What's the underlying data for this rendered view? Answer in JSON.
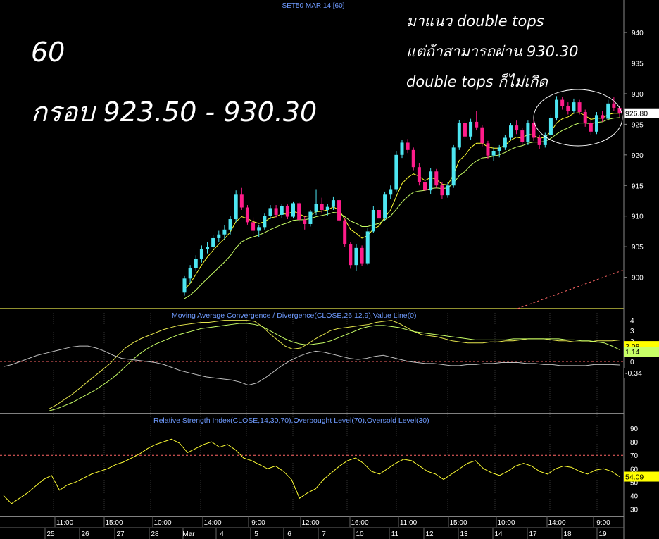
{
  "header": {
    "title": "SET50 MAR 14   [60]"
  },
  "annotations": {
    "timeframe": "60",
    "range": "กรอบ 923.50 - 930.30",
    "note_line1": "มาแนว double tops",
    "note_line2": "แต่ถ้าสามารถผ่าน 930.30",
    "note_line3": "double tops ก็ไม่เกิด"
  },
  "colors": {
    "background": "#000000",
    "bull_candle": "#4de6f2",
    "bear_candle": "#ff1c8a",
    "ma_fast": "#ffff33",
    "ma_slow": "#c8ff66",
    "divider": "#e6e64d",
    "last_price_box": "#ffffff",
    "macd_box": "#ffff00",
    "rsi_box": "#ffff00",
    "axis_text": "#ffffff",
    "indicator_title": "#6f9bff",
    "ref_dashed": "#ff6666"
  },
  "chart_data": [
    {
      "type": "candlestick",
      "title": "SET50 MAR 14   [60]",
      "ylim": [
        895,
        943
      ],
      "yticks": [
        900,
        905,
        910,
        915,
        920,
        925,
        930,
        935,
        940
      ],
      "last_price_label": "926.80",
      "x_time_labels": [
        "11:00",
        "15:00",
        "10:00",
        "14:00",
        "9:00",
        "12:00",
        "16:00",
        "11:00",
        "15:00",
        "10:00",
        "14:00",
        "9:00"
      ],
      "x_date_labels": [
        "25",
        "26",
        "27",
        "28",
        "Mar",
        "4",
        "5",
        "6",
        "7",
        "10",
        "11",
        "12",
        "13",
        "14",
        "17",
        "18",
        "19"
      ],
      "candles": [
        [
          897.5,
          900.2,
          897.0,
          899.8
        ],
        [
          899.8,
          902.0,
          899.0,
          901.5
        ],
        [
          901.5,
          903.6,
          901.0,
          903.0
        ],
        [
          903.0,
          905.2,
          902.4,
          904.6
        ],
        [
          904.6,
          905.8,
          903.9,
          905.0
        ],
        [
          905.0,
          906.9,
          904.5,
          906.4
        ],
        [
          906.4,
          907.6,
          905.8,
          907.0
        ],
        [
          907.0,
          908.5,
          906.2,
          907.8
        ],
        [
          907.8,
          910.0,
          907.0,
          909.5
        ],
        [
          909.5,
          914.2,
          909.0,
          913.5
        ],
        [
          913.5,
          914.6,
          911.0,
          911.4
        ],
        [
          911.4,
          911.8,
          908.6,
          909.0
        ],
        [
          909.0,
          909.8,
          907.0,
          907.6
        ],
        [
          907.6,
          908.6,
          906.6,
          908.2
        ],
        [
          908.2,
          910.4,
          907.8,
          910.0
        ],
        [
          910.0,
          911.8,
          909.5,
          911.3
        ],
        [
          911.3,
          911.8,
          909.8,
          910.2
        ],
        [
          910.2,
          912.0,
          909.7,
          911.6
        ],
        [
          911.6,
          911.9,
          909.5,
          909.9
        ],
        [
          909.9,
          912.4,
          909.6,
          912.1
        ],
        [
          912.1,
          912.3,
          909.0,
          909.4
        ],
        [
          909.4,
          910.0,
          907.8,
          908.7
        ],
        [
          908.7,
          911.0,
          908.3,
          910.7
        ],
        [
          910.7,
          914.4,
          910.2,
          912.0
        ],
        [
          912.0,
          913.0,
          910.4,
          911.0
        ],
        [
          911.0,
          912.0,
          910.1,
          911.5
        ],
        [
          911.5,
          913.2,
          911.0,
          912.6
        ],
        [
          912.6,
          912.9,
          909.0,
          909.3
        ],
        [
          909.3,
          909.6,
          905.0,
          905.4
        ],
        [
          905.4,
          905.7,
          901.4,
          902.0
        ],
        [
          902.0,
          905.4,
          901.0,
          904.8
        ],
        [
          904.8,
          905.2,
          901.8,
          902.3
        ],
        [
          902.3,
          908.0,
          902.0,
          907.5
        ],
        [
          907.5,
          911.6,
          907.2,
          911.0
        ],
        [
          911.0,
          911.5,
          909.0,
          909.6
        ],
        [
          909.6,
          914.0,
          909.2,
          913.5
        ],
        [
          913.5,
          915.0,
          912.8,
          914.4
        ],
        [
          914.4,
          920.6,
          914.0,
          920.0
        ],
        [
          920.0,
          922.5,
          919.5,
          922.0
        ],
        [
          922.0,
          922.6,
          920.3,
          920.8
        ],
        [
          920.8,
          921.2,
          917.5,
          918.0
        ],
        [
          918.0,
          918.6,
          915.0,
          915.6
        ],
        [
          915.6,
          916.2,
          913.6,
          914.2
        ],
        [
          914.2,
          917.8,
          913.6,
          917.3
        ],
        [
          917.3,
          917.7,
          914.6,
          915.0
        ],
        [
          915.0,
          915.6,
          912.8,
          913.4
        ],
        [
          913.4,
          915.5,
          913.0,
          915.0
        ],
        [
          915.0,
          921.6,
          914.6,
          921.2
        ],
        [
          921.2,
          925.7,
          920.8,
          925.2
        ],
        [
          925.2,
          925.6,
          922.6,
          923.0
        ],
        [
          923.0,
          925.9,
          922.5,
          925.4
        ],
        [
          925.4,
          927.2,
          924.0,
          924.5
        ],
        [
          924.5,
          924.9,
          921.4,
          921.9
        ],
        [
          921.9,
          922.3,
          919.3,
          919.9
        ],
        [
          919.9,
          921.2,
          919.0,
          920.6
        ],
        [
          920.6,
          921.6,
          919.6,
          921.2
        ],
        [
          921.2,
          923.3,
          920.8,
          922.8
        ],
        [
          922.8,
          925.2,
          922.4,
          924.8
        ],
        [
          924.8,
          925.6,
          923.4,
          924.0
        ],
        [
          924.0,
          924.4,
          921.6,
          922.1
        ],
        [
          922.1,
          925.6,
          921.6,
          925.2
        ],
        [
          925.2,
          926.0,
          922.3,
          922.8
        ],
        [
          922.8,
          923.3,
          921.0,
          921.6
        ],
        [
          921.6,
          923.6,
          921.2,
          923.2
        ],
        [
          923.2,
          926.6,
          922.8,
          926.0
        ],
        [
          926.0,
          929.6,
          925.6,
          929.0
        ],
        [
          929.0,
          929.5,
          927.4,
          928.0
        ],
        [
          928.0,
          928.6,
          926.6,
          927.2
        ],
        [
          927.2,
          929.2,
          926.9,
          928.6
        ],
        [
          928.6,
          929.0,
          926.6,
          927.0
        ],
        [
          927.0,
          927.4,
          924.6,
          925.2
        ],
        [
          925.2,
          925.6,
          923.2,
          923.8
        ],
        [
          923.8,
          927.0,
          923.4,
          926.5
        ],
        [
          926.5,
          927.2,
          925.4,
          925.9
        ],
        [
          925.9,
          929.0,
          925.6,
          928.4
        ],
        [
          928.4,
          929.4,
          927.2,
          927.7
        ],
        [
          927.7,
          928.0,
          926.2,
          926.8
        ]
      ],
      "series": [
        {
          "name": "",
          "color": "#ffff33",
          "values": [
            898.0,
            899.0,
            900.5,
            902.0,
            903.3,
            904.4,
            905.4,
            906.3,
            907.4,
            909.1,
            909.9,
            909.6,
            909.1,
            908.8,
            909.1,
            909.7,
            909.9,
            910.4,
            910.3,
            910.8,
            910.4,
            909.9,
            910.1,
            910.7,
            910.8,
            911.0,
            911.5,
            911.0,
            909.5,
            907.8,
            907.2,
            906.4,
            906.8,
            907.9,
            908.4,
            909.8,
            911.0,
            913.2,
            915.3,
            916.3,
            916.9,
            916.5,
            915.8,
            916.3,
            916.0,
            915.2,
            915.1,
            916.8,
            919.1,
            919.9,
            921.2,
            921.9,
            921.9,
            921.3,
            921.1,
            921.1,
            921.6,
            922.4,
            922.9,
            922.7,
            923.4,
            923.2,
            922.7,
            922.9,
            923.8,
            925.2,
            925.9,
            926.2,
            926.8,
            926.9,
            926.4,
            925.8,
            926.0,
            926.0,
            926.6,
            926.8,
            926.8
          ]
        },
        {
          "name": "",
          "color": "#c8ff66",
          "values": [
            896.5,
            897.1,
            897.9,
            898.9,
            899.8,
            900.7,
            901.6,
            902.5,
            903.5,
            904.8,
            905.8,
            906.3,
            906.6,
            906.9,
            907.3,
            907.8,
            908.2,
            908.6,
            908.9,
            909.3,
            909.4,
            909.4,
            909.6,
            909.9,
            910.1,
            910.3,
            910.6,
            910.5,
            909.9,
            909.2,
            908.8,
            908.3,
            908.3,
            908.6,
            908.8,
            909.4,
            910.0,
            911.1,
            912.3,
            913.2,
            913.9,
            914.1,
            914.2,
            914.5,
            914.6,
            914.5,
            914.6,
            915.4,
            916.6,
            917.3,
            918.3,
            919.0,
            919.5,
            919.6,
            919.8,
            920.0,
            920.4,
            920.9,
            921.3,
            921.5,
            921.9,
            922.1,
            922.1,
            922.2,
            922.7,
            923.4,
            924.0,
            924.4,
            924.9,
            925.2,
            925.2,
            925.1,
            925.3,
            925.4,
            925.8,
            926.0,
            926.1
          ]
        }
      ],
      "annotation_shapes": [
        "ellipse-around-double-top",
        "dashed-support-line"
      ]
    },
    {
      "type": "line",
      "title": "Moving Average Convergence / Divergence(CLOSE,26,12,9),Value Line(0)",
      "ylim": [
        -5,
        5
      ],
      "yticks": [
        -4,
        -3,
        -2,
        -1,
        0,
        1,
        2,
        3,
        4
      ],
      "visible_tick_labels": [
        "4",
        "3",
        "2",
        "1",
        "0"
      ],
      "value_labels": [
        "2.08",
        "1.14",
        "-0.34"
      ],
      "series": [
        {
          "name": "",
          "color": "#e6e64d",
          "values": [
            -4.6,
            -4.2,
            -3.7,
            -3.2,
            -2.6,
            -2.0,
            -1.4,
            -0.8,
            -0.2,
            0.6,
            1.3,
            1.8,
            2.2,
            2.5,
            2.8,
            3.1,
            3.3,
            3.5,
            3.6,
            3.7,
            3.8,
            3.8,
            3.9,
            4.0,
            4.0,
            4.0,
            4.0,
            3.9,
            3.4,
            2.7,
            2.1,
            1.5,
            1.2,
            1.3,
            1.7,
            2.2,
            2.6,
            3.0,
            3.2,
            3.3,
            3.4,
            3.5,
            3.6,
            3.8,
            3.9,
            4.0,
            3.7,
            3.3,
            2.9,
            2.6,
            2.5,
            2.4,
            2.2,
            2.0,
            1.9,
            1.8,
            1.8,
            1.8,
            1.9,
            1.9,
            2.0,
            2.0,
            2.1,
            2.2,
            2.2,
            2.2,
            2.1,
            2.0,
            2.0,
            1.9,
            1.9,
            1.9,
            2.0,
            2.0,
            2.0,
            2.08
          ]
        },
        {
          "name": "",
          "color": "#c8ff66",
          "values": [
            -4.8,
            -4.6,
            -4.3,
            -4.0,
            -3.6,
            -3.2,
            -2.8,
            -2.3,
            -1.8,
            -1.2,
            -0.5,
            0.2,
            0.8,
            1.3,
            1.7,
            2.0,
            2.3,
            2.6,
            2.8,
            3.0,
            3.2,
            3.3,
            3.4,
            3.5,
            3.6,
            3.7,
            3.7,
            3.6,
            3.4,
            3.0,
            2.6,
            2.2,
            1.9,
            1.7,
            1.6,
            1.7,
            1.8,
            2.0,
            2.3,
            2.6,
            2.9,
            3.2,
            3.4,
            3.5,
            3.5,
            3.4,
            3.3,
            3.1,
            2.9,
            2.8,
            2.7,
            2.6,
            2.5,
            2.4,
            2.3,
            2.2,
            2.1,
            2.1,
            2.1,
            2.1,
            2.1,
            2.2,
            2.2,
            2.2,
            2.2,
            2.2,
            2.2,
            2.2,
            2.1,
            2.1,
            2.0,
            2.0,
            1.9,
            1.8,
            1.5,
            1.14
          ]
        },
        {
          "name": "",
          "color": "#bfbfbf",
          "values": [
            -0.5,
            -0.3,
            0.0,
            0.3,
            0.6,
            0.8,
            1.0,
            1.2,
            1.4,
            1.5,
            1.5,
            1.3,
            1.0,
            0.6,
            0.3,
            0.2,
            0.1,
            0.0,
            -0.1,
            -0.3,
            -0.6,
            -0.9,
            -1.1,
            -1.3,
            -1.5,
            -1.6,
            -1.7,
            -1.8,
            -2.0,
            -2.3,
            -2.1,
            -1.6,
            -1.0,
            -0.4,
            0.1,
            0.5,
            0.8,
            1.0,
            0.9,
            0.7,
            0.5,
            0.3,
            0.2,
            0.3,
            0.5,
            0.6,
            0.4,
            0.2,
            0.0,
            -0.1,
            -0.2,
            -0.2,
            -0.3,
            -0.4,
            -0.4,
            -0.3,
            -0.3,
            -0.2,
            -0.2,
            -0.1,
            -0.1,
            -0.1,
            -0.2,
            -0.2,
            -0.3,
            -0.3,
            -0.4,
            -0.4,
            -0.4,
            -0.4,
            -0.3,
            -0.3,
            -0.3,
            -0.34
          ]
        }
      ]
    },
    {
      "type": "line",
      "title": "Relative Strength Index(CLOSE,14,30,70),Overbought Level(70),Oversold Level(30)",
      "ylim": [
        25,
        100
      ],
      "yticks": [
        30,
        40,
        50,
        60,
        70,
        80,
        90
      ],
      "overbought": 70,
      "oversold": 30,
      "value_label": "54.09",
      "series": [
        {
          "name": "",
          "color": "#ffff33",
          "values": [
            40,
            34,
            38,
            42,
            47,
            52,
            55,
            44,
            48,
            50,
            53,
            56,
            58,
            60,
            63,
            65,
            68,
            71,
            75,
            78,
            80,
            82,
            79,
            72,
            75,
            78,
            80,
            76,
            78,
            74,
            68,
            66,
            63,
            60,
            62,
            58,
            52,
            38,
            42,
            45,
            52,
            57,
            62,
            66,
            68,
            64,
            58,
            56,
            60,
            64,
            67,
            66,
            62,
            58,
            56,
            52,
            56,
            60,
            64,
            66,
            60,
            57,
            55,
            58,
            62,
            64,
            62,
            58,
            56,
            60,
            62,
            61,
            58,
            56,
            59,
            60,
            58,
            54.09
          ]
        }
      ]
    }
  ]
}
